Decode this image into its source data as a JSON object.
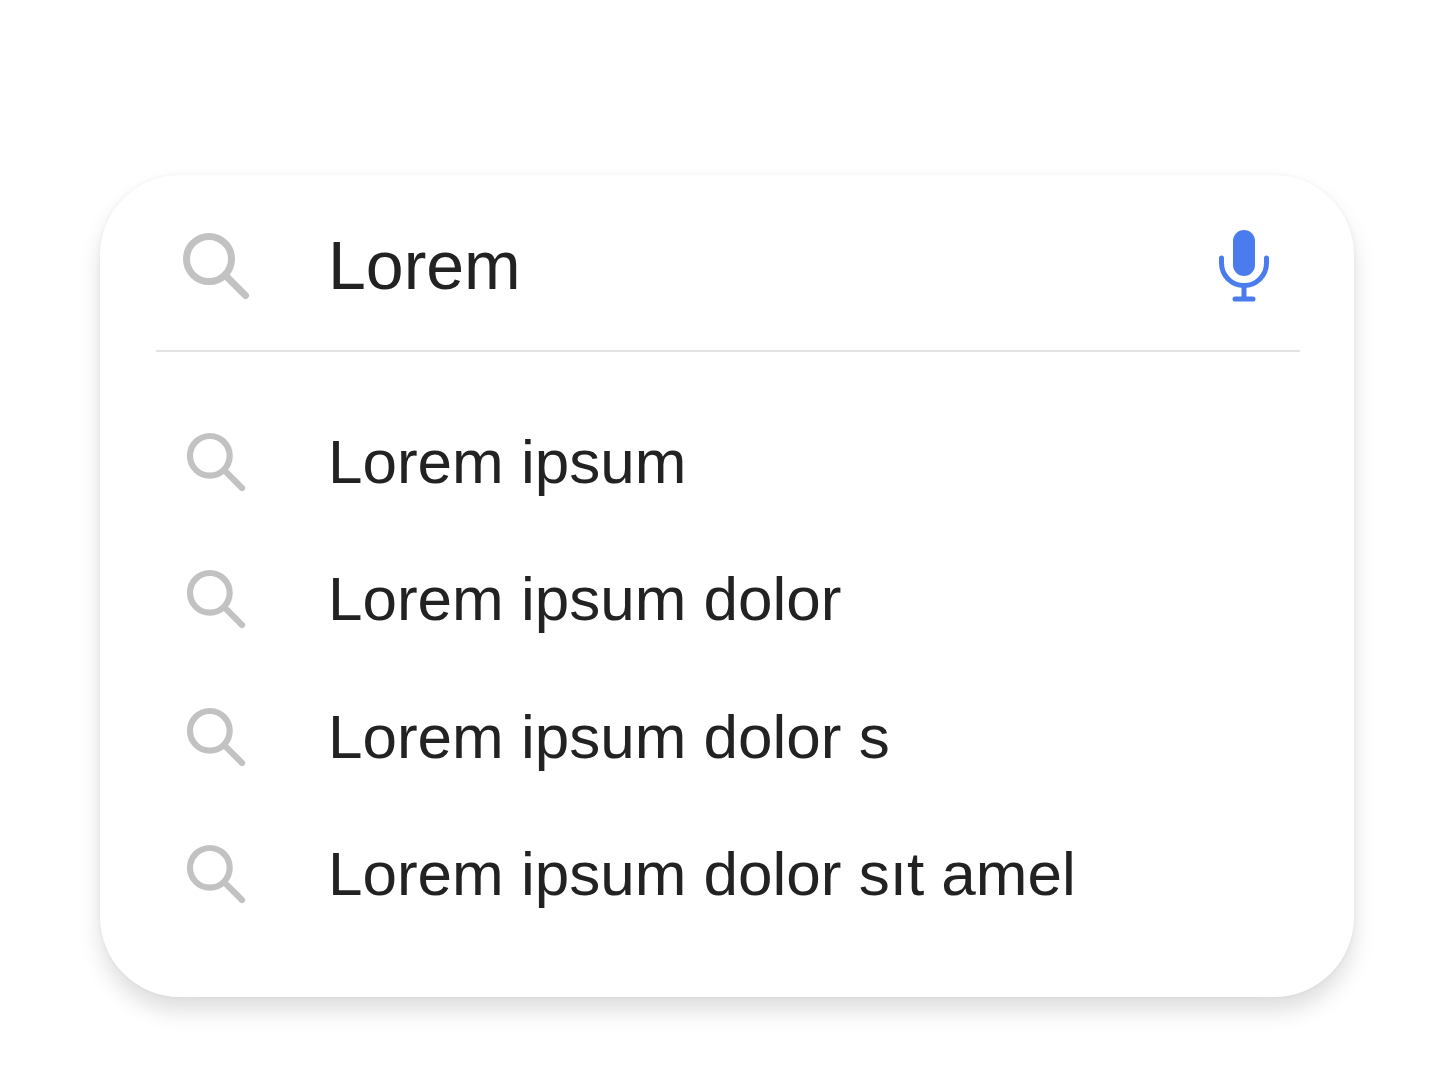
{
  "search": {
    "value": "Lorem"
  },
  "suggestions": [
    "Lorem ipsum",
    "Lorem ipsum dolor",
    "Lorem ipsum dolor s",
    "Lorem ipsum dolor sıt amel"
  ]
}
